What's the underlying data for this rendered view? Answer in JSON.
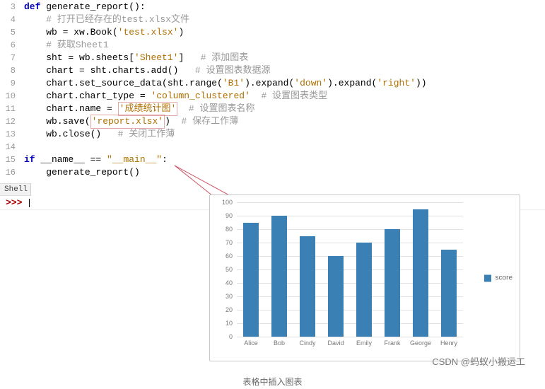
{
  "gutter": {
    "l3": "3",
    "l4": "4",
    "l5": "5",
    "l6": "6",
    "l7": "7",
    "l8": "8",
    "l9": "9",
    "l10": "10",
    "l11": "11",
    "l12": "12",
    "l13": "13",
    "l14": "14",
    "l15": "15",
    "l16": "16"
  },
  "code": {
    "def": "def ",
    "fn_name": "generate_report",
    "paren": "():",
    "c4": "# 打开已经存在的test.xlsx文件",
    "l5a": "wb = xw.Book(",
    "l5s": "'test.xlsx'",
    "l5b": ")",
    "c6": "# 获取Sheet1",
    "l7a": "sht = wb.sheets[",
    "l7s": "'Sheet1'",
    "l7b": "]   ",
    "c7": "# 添加图表",
    "l8a": "chart = sht.charts.add()   ",
    "c8": "# 设置图表数据源",
    "l9a": "chart.set_source_data(sht.range(",
    "l9s1": "'B1'",
    "l9b": ").expand(",
    "l9s2": "'down'",
    "l9c": ").expand(",
    "l9s3": "'right'",
    "l9d": "))",
    "l10a": "chart.chart_type = ",
    "l10s": "'column_clustered'",
    "l10b": "  ",
    "c10": "# 设置图表类型",
    "l11a": "chart.name = ",
    "l11s": "'成绩统计图'",
    "l11b": "  ",
    "c11": "# 设置图表名称",
    "l12a": "wb.save(",
    "l12s": "'report.xlsx'",
    "l12b": ")  ",
    "c12": "# 保存工作薄",
    "l13a": "wb.close()   ",
    "c13": "# 关闭工作薄",
    "if": "if ",
    "dname": "__name__",
    "eq": " == ",
    "main": "\"__main__\"",
    "colon": ":",
    "l16": "generate_report()"
  },
  "shell": {
    "label": "Shell",
    "prompt": ">>> "
  },
  "watermark": "CSDN @蚂蚁小搬运工",
  "caption": "表格中插入图表",
  "chart_data": {
    "type": "bar",
    "categories": [
      "Alice",
      "Bob",
      "Cindy",
      "David",
      "Emily",
      "Frank",
      "George",
      "Henry"
    ],
    "values": [
      85,
      90,
      75,
      60,
      70,
      80,
      95,
      65
    ],
    "series": [
      {
        "name": "score",
        "values": [
          85,
          90,
          75,
          60,
          70,
          80,
          95,
          65
        ]
      }
    ],
    "title": "",
    "xlabel": "",
    "ylabel": "",
    "ylim": [
      0,
      100
    ],
    "yticks": [
      0,
      10,
      20,
      30,
      40,
      50,
      60,
      70,
      80,
      90,
      100
    ],
    "legend": "score",
    "bar_color": "#3a80b5"
  }
}
